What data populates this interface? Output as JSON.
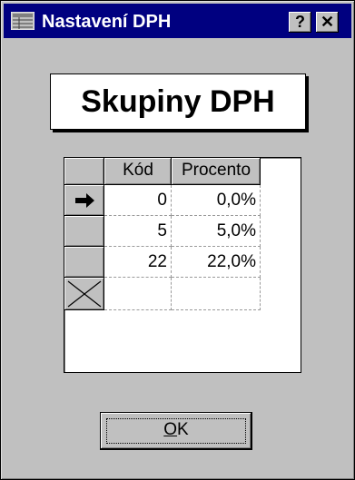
{
  "window": {
    "title": "Nastavení DPH",
    "help_button": "?",
    "close_button": "✕"
  },
  "heading": "Skupiny DPH",
  "table": {
    "columns": [
      "Kód",
      "Procento"
    ],
    "rows": [
      {
        "kod": "0",
        "procento": "0,0%",
        "current": true
      },
      {
        "kod": "5",
        "procento": "5,0%"
      },
      {
        "kod": "22",
        "procento": "22,0%"
      }
    ]
  },
  "ok_button": {
    "label_first": "O",
    "label_rest": "K"
  }
}
